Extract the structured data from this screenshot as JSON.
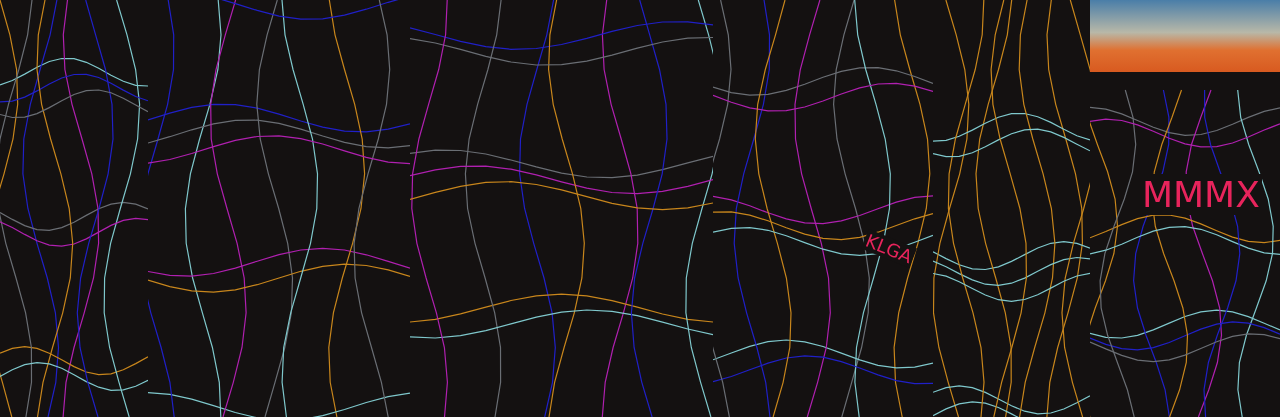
{
  "panels": [
    {
      "kind": "map"
    },
    {
      "kind": "map"
    },
    {
      "kind": "map"
    },
    {
      "kind": "map",
      "label": "KLGA"
    },
    {
      "kind": "map"
    },
    {
      "kind": "horizon",
      "label": "MMMX"
    }
  ]
}
